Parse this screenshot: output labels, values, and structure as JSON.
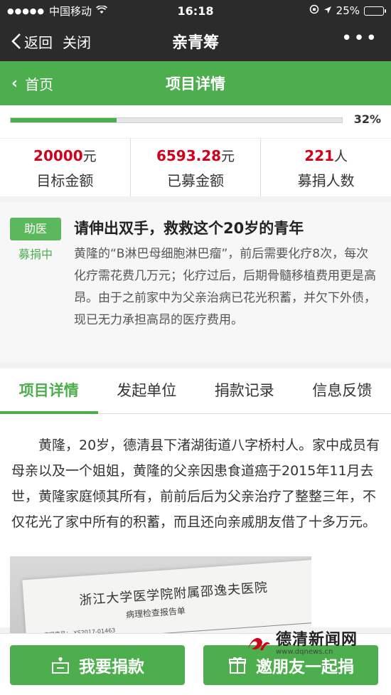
{
  "status_bar": {
    "signal": "●●●●●",
    "carrier": "中国移动",
    "time": "16:18",
    "battery_pct": "25%",
    "battery_level": 0.25
  },
  "header": {
    "back_label": "返回",
    "close_label": "关闭",
    "title": "亲青筹",
    "more_label": "•••"
  },
  "nav": {
    "home_label": "首页",
    "title": "项目详情"
  },
  "progress": {
    "percent_label": "32%",
    "fraction": 0.32
  },
  "stats": [
    {
      "value": "20000",
      "unit": "元",
      "label": "目标金额"
    },
    {
      "value": "6593.28",
      "unit": "元",
      "label": "已募金额"
    },
    {
      "value": "221",
      "unit": "人",
      "label": "募捐人数"
    }
  ],
  "project": {
    "tag": "助医",
    "status": "募捐中",
    "title": "请伸出双手，救救这个20岁的青年",
    "description": "黄隆的“B淋巴母细胞淋巴瘤”，前后需要化疗8次，每次化疗需花费几万元；化疗过后，后期骨髓移植费用更是高昂。由于之前家中为父亲治病已花光积蓄，并欠下外债，现已无力承担高昂的医疗费用。"
  },
  "tabs": [
    {
      "label": "项目详情",
      "active": true
    },
    {
      "label": "发起单位",
      "active": false
    },
    {
      "label": "捐款记录",
      "active": false
    },
    {
      "label": "信息反馈",
      "active": false
    }
  ],
  "detail": {
    "text": "黄隆，20岁，德清县下渚湖街道八字桥村人。家中成员有母亲以及一个姐姐，黄隆的父亲因患食道癌于2015年11月去世，黄隆家庭倾其所有，前前后后为父亲治疗了整整三年，不仅花光了家中所有的积蓄，而且还向亲戚朋友借了十多万元。",
    "photo": {
      "hospital": "浙江大学医学院附属邵逸夫医院",
      "report": "病理检查报告单",
      "row": "病理序号： XS2017-01463"
    }
  },
  "actions": {
    "donate_label": "我要捐款",
    "invite_label": "邀朋友一起捐"
  },
  "watermark": {
    "name": "德清新闻网",
    "url": "www.dqnews.cn"
  },
  "colors": {
    "green": "#4cae4c",
    "dark_header": "#2b2b2b",
    "amount_red": "#d0021b"
  }
}
